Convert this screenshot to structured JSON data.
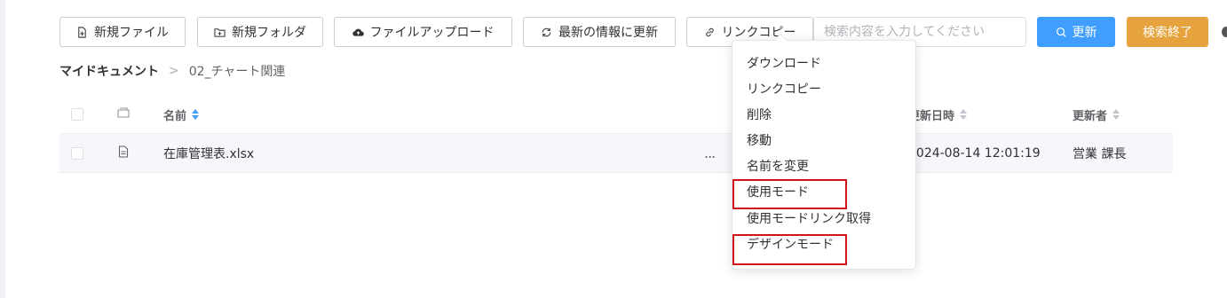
{
  "toolbar": {
    "new_file": "新規ファイル",
    "new_folder": "新規フォルダ",
    "file_upload": "ファイルアップロード",
    "refresh_latest": "最新の情報に更新",
    "copy_link": "リンクコピー"
  },
  "search": {
    "placeholder": "検索内容を入力してください",
    "value": ""
  },
  "actions": {
    "refresh": "更新",
    "end_search": "検索終了"
  },
  "breadcrumb": {
    "root": "マイドキュメント",
    "separator": ">",
    "current": "02_チャート関連"
  },
  "table": {
    "columns": {
      "name": "名前",
      "updated_at": "更新日時",
      "updated_by": "更新者"
    },
    "rows": [
      {
        "name": "在庫管理表.xlsx",
        "more": "...",
        "updated_at": "2024-08-14 12:01:19",
        "updated_by": "営業 課長"
      }
    ]
  },
  "context_menu": {
    "items": [
      "ダウンロード",
      "リンクコピー",
      "削除",
      "移動",
      "名前を変更",
      "使用モード",
      "使用モードリンク取得",
      "デザインモード"
    ],
    "highlighted": [
      "使用モード",
      "デザインモード"
    ]
  },
  "colors": {
    "primary": "#409eff",
    "warning": "#e6a23c",
    "highlight_border": "#d0121b"
  },
  "icons": {
    "new_file": "file-plus-icon",
    "new_folder": "folder-plus-icon",
    "upload": "cloud-upload-icon",
    "refresh": "refresh-icon",
    "link": "link-icon",
    "search": "search-icon",
    "file_type_header": "folder-icon",
    "document": "document-icon"
  }
}
